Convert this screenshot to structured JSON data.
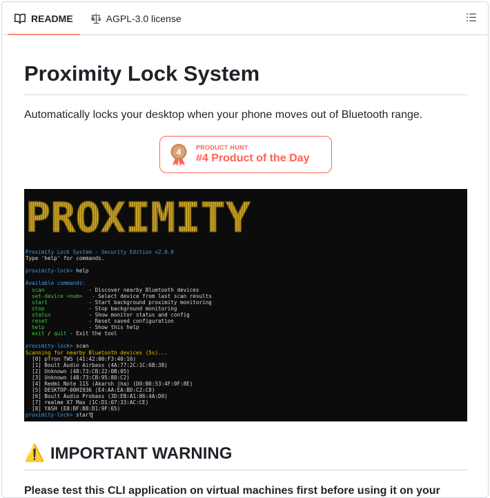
{
  "tabs": [
    {
      "label": "README",
      "icon": "book-icon",
      "active": true
    },
    {
      "label": "AGPL-3.0 license",
      "icon": "scale-icon",
      "active": false
    }
  ],
  "outline_icon": "list-unordered-icon",
  "readme": {
    "title": "Proximity Lock System",
    "tagline": "Automatically locks your desktop when your phone moves out of Bluetooth range.",
    "product_hunt": {
      "kicker": "PRODUCT HUNT",
      "title": "#4 Product of the Day",
      "rank": "4",
      "color": "#ff6154"
    },
    "terminal": {
      "banner": "PROXIMITY",
      "lines": [
        {
          "segments": [
            {
              "t": "Proximity Lock System - Security Edition v2.0.0",
              "c": "blue"
            }
          ]
        },
        {
          "segments": [
            {
              "t": "Type 'help' for commands.",
              "c": "white"
            }
          ]
        },
        {
          "segments": []
        },
        {
          "segments": [
            {
              "t": "proximity-lock> ",
              "c": "blue"
            },
            {
              "t": "help",
              "c": "white"
            }
          ]
        },
        {
          "segments": []
        },
        {
          "segments": [
            {
              "t": "Available commands:",
              "c": "blue"
            }
          ]
        },
        {
          "segments": [
            {
              "t": "  scan              ",
              "c": "green"
            },
            {
              "t": "- Discover nearby Bluetooth devices",
              "c": "white"
            }
          ]
        },
        {
          "segments": [
            {
              "t": "  set-device <num>  ",
              "c": "green"
            },
            {
              "t": " - Select device from last scan results",
              "c": "white"
            }
          ]
        },
        {
          "segments": [
            {
              "t": "  start             ",
              "c": "green"
            },
            {
              "t": "- Start background proximity monitoring",
              "c": "white"
            }
          ]
        },
        {
          "segments": [
            {
              "t": "  stop              ",
              "c": "green"
            },
            {
              "t": "- Stop background monitoring",
              "c": "white"
            }
          ]
        },
        {
          "segments": [
            {
              "t": "  status            ",
              "c": "green"
            },
            {
              "t": "- Show monitor status and config",
              "c": "white"
            }
          ]
        },
        {
          "segments": [
            {
              "t": "  reset             ",
              "c": "green"
            },
            {
              "t": "- Reset saved configuration",
              "c": "white"
            }
          ]
        },
        {
          "segments": [
            {
              "t": "  help              ",
              "c": "green"
            },
            {
              "t": "- Show this help",
              "c": "white"
            }
          ]
        },
        {
          "segments": [
            {
              "t": "  exit",
              "c": "green"
            },
            {
              "t": " / ",
              "c": "white"
            },
            {
              "t": "quit",
              "c": "green"
            },
            {
              "t": " - Exit the tool",
              "c": "white"
            }
          ]
        },
        {
          "segments": []
        },
        {
          "segments": [
            {
              "t": "proximity-lock> ",
              "c": "blue"
            },
            {
              "t": "scan",
              "c": "white"
            }
          ]
        },
        {
          "segments": [
            {
              "t": "Scanning for nearby Bluetooth devices (5s)...",
              "c": "yellow"
            }
          ]
        },
        {
          "segments": [
            {
              "t": "  [0] pTron TWS (41:42:00:F3:40:16)",
              "c": "white"
            }
          ]
        },
        {
          "segments": [
            {
              "t": "  [1] Boult Audio Airbass (4A:77:2C:1C:6B:38)",
              "c": "white"
            }
          ]
        },
        {
          "segments": [
            {
              "t": "  [2] Unknown (48:73:CB:22:0B:05)",
              "c": "white"
            }
          ]
        },
        {
          "segments": [
            {
              "t": "  [3] Unknown (48:73:CB:95:80:C2)",
              "c": "white"
            }
          ]
        },
        {
          "segments": [
            {
              "t": "  [4] Redmi Note 11S (Akarsh jha) (D0:B0:53:4F:0F:8E)",
              "c": "white"
            }
          ]
        },
        {
          "segments": [
            {
              "t": "  [5] DESKTOP-00HI936 (E4:AA:EA:BD:C2:C0)",
              "c": "white"
            }
          ]
        },
        {
          "segments": [
            {
              "t": "  [6] Boult Audio Probass (3D:EB:A1:86:4A:D0)",
              "c": "white"
            }
          ]
        },
        {
          "segments": [
            {
              "t": "  [7] realme X7 Max (1C:D1:07:33:AC:CE)",
              "c": "white"
            }
          ]
        },
        {
          "segments": [
            {
              "t": "  [8] YASH (E8:BF:B8:D1:9F:65)",
              "c": "white"
            }
          ]
        },
        {
          "segments": [
            {
              "t": "proximity-lock> ",
              "c": "blue"
            },
            {
              "t": "start",
              "c": "white"
            }
          ],
          "cursor": true
        }
      ]
    },
    "warning": {
      "emoji": "⚠️",
      "heading": "IMPORTANT WARNING",
      "text": "Please test this CLI application on virtual machines first before using it on your"
    }
  },
  "colors": {
    "tab_underline": "#fd8c73",
    "banner_gold": "#c9a227",
    "terminal_bg": "#0c0c0c"
  }
}
